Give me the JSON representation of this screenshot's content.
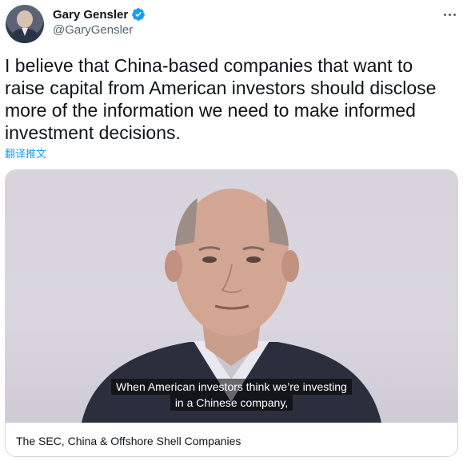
{
  "author": {
    "name": "Gary Gensler",
    "handle": "@GaryGensler"
  },
  "tweet": {
    "text": "I believe that China-based companies that want to raise capital from American investors should disclose more of the information we need to make informed investment decisions.",
    "translate_label": "翻译推文"
  },
  "card": {
    "caption_line1": "When American investors think we’re investing",
    "caption_line2": "in a Chinese company,",
    "title": "The SEC, China & Offshore Shell Companies"
  },
  "icons": {
    "verified": "verified-badge-icon",
    "more": "more-options-icon"
  },
  "colors": {
    "accent": "#1d9bf0",
    "text": "#0f1419",
    "secondary": "#536471",
    "border": "#cfd9de"
  }
}
